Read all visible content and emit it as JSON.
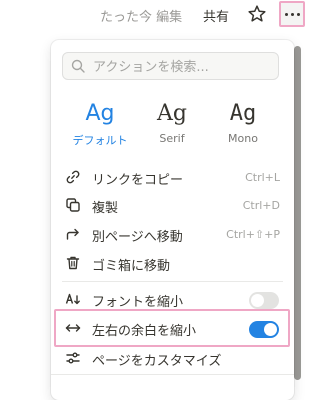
{
  "topbar": {
    "edited_label": "たった今 編集",
    "share_label": "共有",
    "favorite_icon": "star-icon",
    "more_icon": "more-horizontal-icon",
    "more_highlight_color": "#efa7c5"
  },
  "menu": {
    "search": {
      "placeholder": "アクションを検索..."
    },
    "fonts": [
      {
        "glyph": "Ag",
        "name": "デフォルト",
        "selected": true
      },
      {
        "glyph": "Ag",
        "name": "Serif",
        "selected": false
      },
      {
        "glyph": "Ag",
        "name": "Mono",
        "selected": false
      }
    ],
    "actions": [
      {
        "label": "リンクをコピー",
        "shortcut": "Ctrl+L",
        "icon": "link-icon"
      },
      {
        "label": "複製",
        "shortcut": "Ctrl+D",
        "icon": "duplicate-icon"
      },
      {
        "label": "別ページへ移動",
        "shortcut": "Ctrl+⇧+P",
        "icon": "move-arrow-icon"
      },
      {
        "label": "ゴミ箱に移動",
        "shortcut": "",
        "icon": "trash-icon"
      }
    ],
    "toggles": [
      {
        "label": "フォントを縮小",
        "icon": "small-text-icon",
        "on": false
      },
      {
        "label": "左右の余白を縮小",
        "icon": "full-width-icon",
        "on": true
      }
    ],
    "customize": {
      "label": "ページをカスタマイズ",
      "icon": "customize-sliders-icon"
    }
  },
  "colors": {
    "accent": "#2383e2",
    "text": "#37352f",
    "muted": "#9b9a97",
    "highlight": "#efa7c5"
  }
}
